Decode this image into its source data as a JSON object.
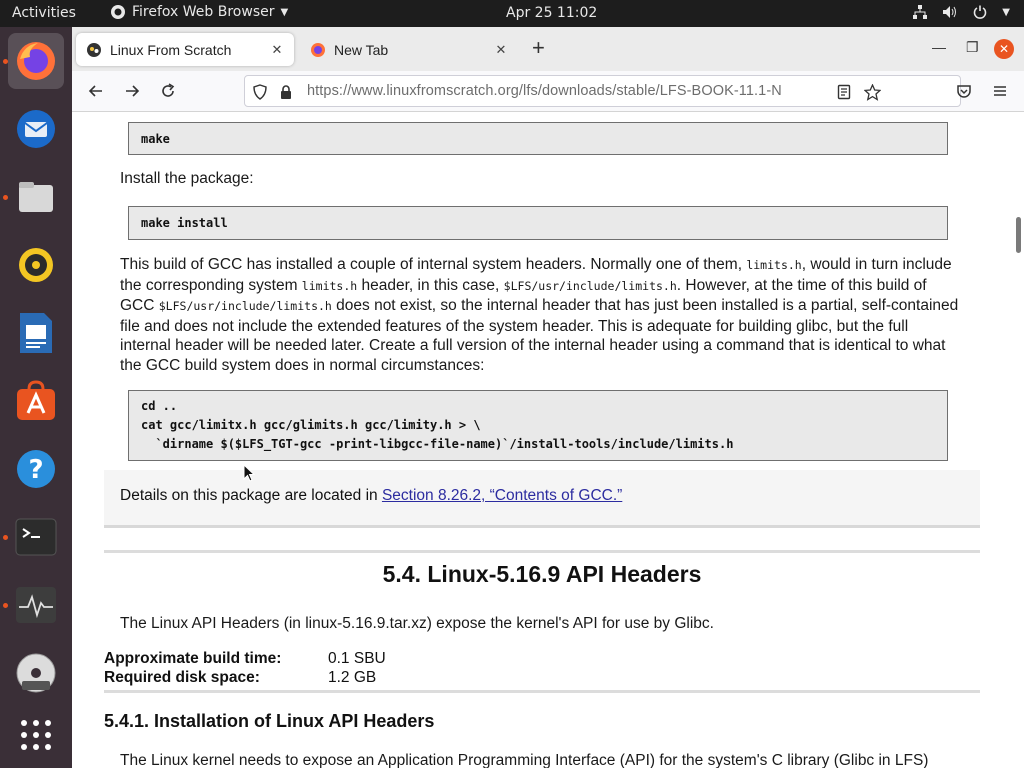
{
  "topbar": {
    "activities": "Activities",
    "app_name": "Firefox Web Browser",
    "clock": "Apr 25  11:02",
    "icons": [
      "network-icon",
      "volume-icon",
      "power-icon",
      "chevron-down-icon"
    ]
  },
  "dock": {
    "items": [
      {
        "name": "firefox",
        "icon": "firefox-icon",
        "active": true,
        "running": true
      },
      {
        "name": "thunderbird",
        "icon": "mail-icon",
        "active": false,
        "running": false
      },
      {
        "name": "files",
        "icon": "folder-icon",
        "active": false,
        "running": true
      },
      {
        "name": "rhythmbox",
        "icon": "music-icon",
        "active": false,
        "running": false
      },
      {
        "name": "writer",
        "icon": "document-icon",
        "active": false,
        "running": false
      },
      {
        "name": "software",
        "icon": "store-icon",
        "active": false,
        "running": false
      },
      {
        "name": "help",
        "icon": "help-icon",
        "active": false,
        "running": false
      },
      {
        "name": "terminal",
        "icon": "terminal-icon",
        "active": false,
        "running": true
      },
      {
        "name": "system-monitor",
        "icon": "monitor-icon",
        "active": false,
        "running": true
      },
      {
        "name": "dvd",
        "icon": "disc-icon",
        "active": false,
        "running": false
      },
      {
        "name": "app-grid",
        "icon": "grid-icon",
        "active": false,
        "running": false
      }
    ]
  },
  "browser": {
    "tabs": [
      {
        "title": "Linux From Scratch",
        "selected": true,
        "icon": "lfs-favicon-icon"
      },
      {
        "title": "New Tab",
        "selected": false,
        "icon": "firefox-icon"
      }
    ],
    "url_host": "https://www.linuxfromscratch.org",
    "url_path": "/lfs/downloads/stable/LFS-BOOK-11.1-N"
  },
  "page": {
    "code1": "make",
    "install_label": "Install the package:",
    "code2": "make install",
    "para1": {
      "t1": "This build of GCC has installed a couple of internal system headers. Normally one of them, ",
      "c1": "limits.h",
      "t2": ", would in turn include the corresponding system ",
      "c2": "limits.h",
      "t3": " header, in this case, ",
      "c3": "$LFS/usr/include/limits.h",
      "t4": ". However, at the time of this build of GCC ",
      "c4": "$LFS/usr/include/limits.h",
      "t5": " does not exist, so the internal header that has just been installed is a partial, self-contained file and does not include the extended features of the system header. This is adequate for building glibc, but the full internal header will be needed later. Create a full version of the internal header using a command that is identical to what the GCC build system does in normal circumstances:"
    },
    "code3": [
      "cd ..",
      "cat gcc/limitx.h gcc/glimits.h gcc/limity.h > \\",
      "  `dirname $($LFS_TGT-gcc -print-libgcc-file-name)`/install-tools/include/limits.h"
    ],
    "details_text": "Details on this package are located in ",
    "details_link": "Section 8.26.2, “Contents of GCC.”",
    "section_title": "5.4. Linux-5.16.9 API Headers",
    "section_intro": "The Linux API Headers (in linux-5.16.9.tar.xz) expose the kernel's API for use by Glibc.",
    "build_time_label": "Approximate build time:",
    "build_time_value": "0.1 SBU",
    "disk_space_label": "Required disk space:",
    "disk_space_value": "1.2 GB",
    "subsection_title": "5.4.1. Installation of Linux API Headers",
    "subsection_intro": "The Linux kernel needs to expose an Application Programming Interface (API) for the system's C library (Glibc in LFS)"
  },
  "colors": {
    "accent": "#e95420",
    "dock_bg": "#3a2f37",
    "topbar_bg": "#1d1d1d",
    "link": "#2c2ca0"
  }
}
